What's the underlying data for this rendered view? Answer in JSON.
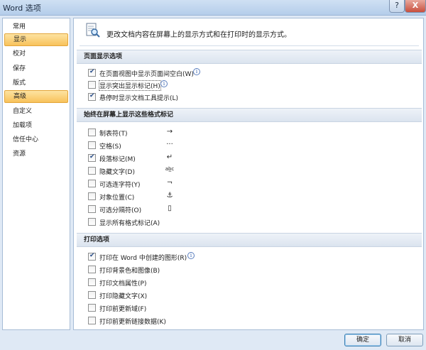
{
  "window": {
    "title": "Word 选项",
    "help_glyph": "?",
    "close_glyph": "X"
  },
  "sidebar": {
    "items": [
      {
        "label": "常用"
      },
      {
        "label": "显示",
        "selected": true
      },
      {
        "label": "校对"
      },
      {
        "label": "保存"
      },
      {
        "label": "版式"
      },
      {
        "label": "高级",
        "selected": true
      },
      {
        "label": "自定义"
      },
      {
        "label": "加载项"
      },
      {
        "label": "信任中心"
      },
      {
        "label": "资源"
      }
    ]
  },
  "intro": {
    "text": "更改文档内容在屏幕上的显示方式和在打印时的显示方式。"
  },
  "sections": {
    "page_display": {
      "title": "页面显示选项",
      "options": [
        {
          "label": "在页面视图中显示页面间空白(W)",
          "checked": true,
          "info": true
        },
        {
          "label": "显示突出显示标记(H)",
          "checked": false,
          "info": true
        },
        {
          "label": "悬停时显示文档工具提示(L)",
          "checked": true
        }
      ]
    },
    "format_marks": {
      "title": "始终在屏幕上显示这些格式标记",
      "options": [
        {
          "label": "制表符(T)",
          "checked": false,
          "symbol": "→"
        },
        {
          "label": "空格(S)",
          "checked": false,
          "symbol": "···"
        },
        {
          "label": "段落标记(M)",
          "checked": true,
          "symbol": "↵"
        },
        {
          "label": "隐藏文字(D)",
          "checked": false,
          "symbol": "ab̲c"
        },
        {
          "label": "可选连字符(Y)",
          "checked": false,
          "symbol": "¬"
        },
        {
          "label": "对象位置(C)",
          "checked": false,
          "symbol": "⚓"
        },
        {
          "label": "可选分隔符(O)",
          "checked": false,
          "symbol": "▯"
        },
        {
          "label": "显示所有格式标记(A)",
          "checked": false
        }
      ]
    },
    "print": {
      "title": "打印选项",
      "options": [
        {
          "label": "打印在 Word 中创建的图形(R)",
          "checked": true,
          "info": true
        },
        {
          "label": "打印背景色和图像(B)",
          "checked": false
        },
        {
          "label": "打印文档属性(P)",
          "checked": false
        },
        {
          "label": "打印隐藏文字(X)",
          "checked": false
        },
        {
          "label": "打印前更新域(F)",
          "checked": false
        },
        {
          "label": "打印前更新链接数据(K)",
          "checked": false
        }
      ]
    }
  },
  "buttons": {
    "ok": "确定",
    "cancel": "取消"
  },
  "colors": {
    "selected_nav": "#f8c25b",
    "window_chrome": "#b9d3ee",
    "close_button": "#c84f3d"
  }
}
